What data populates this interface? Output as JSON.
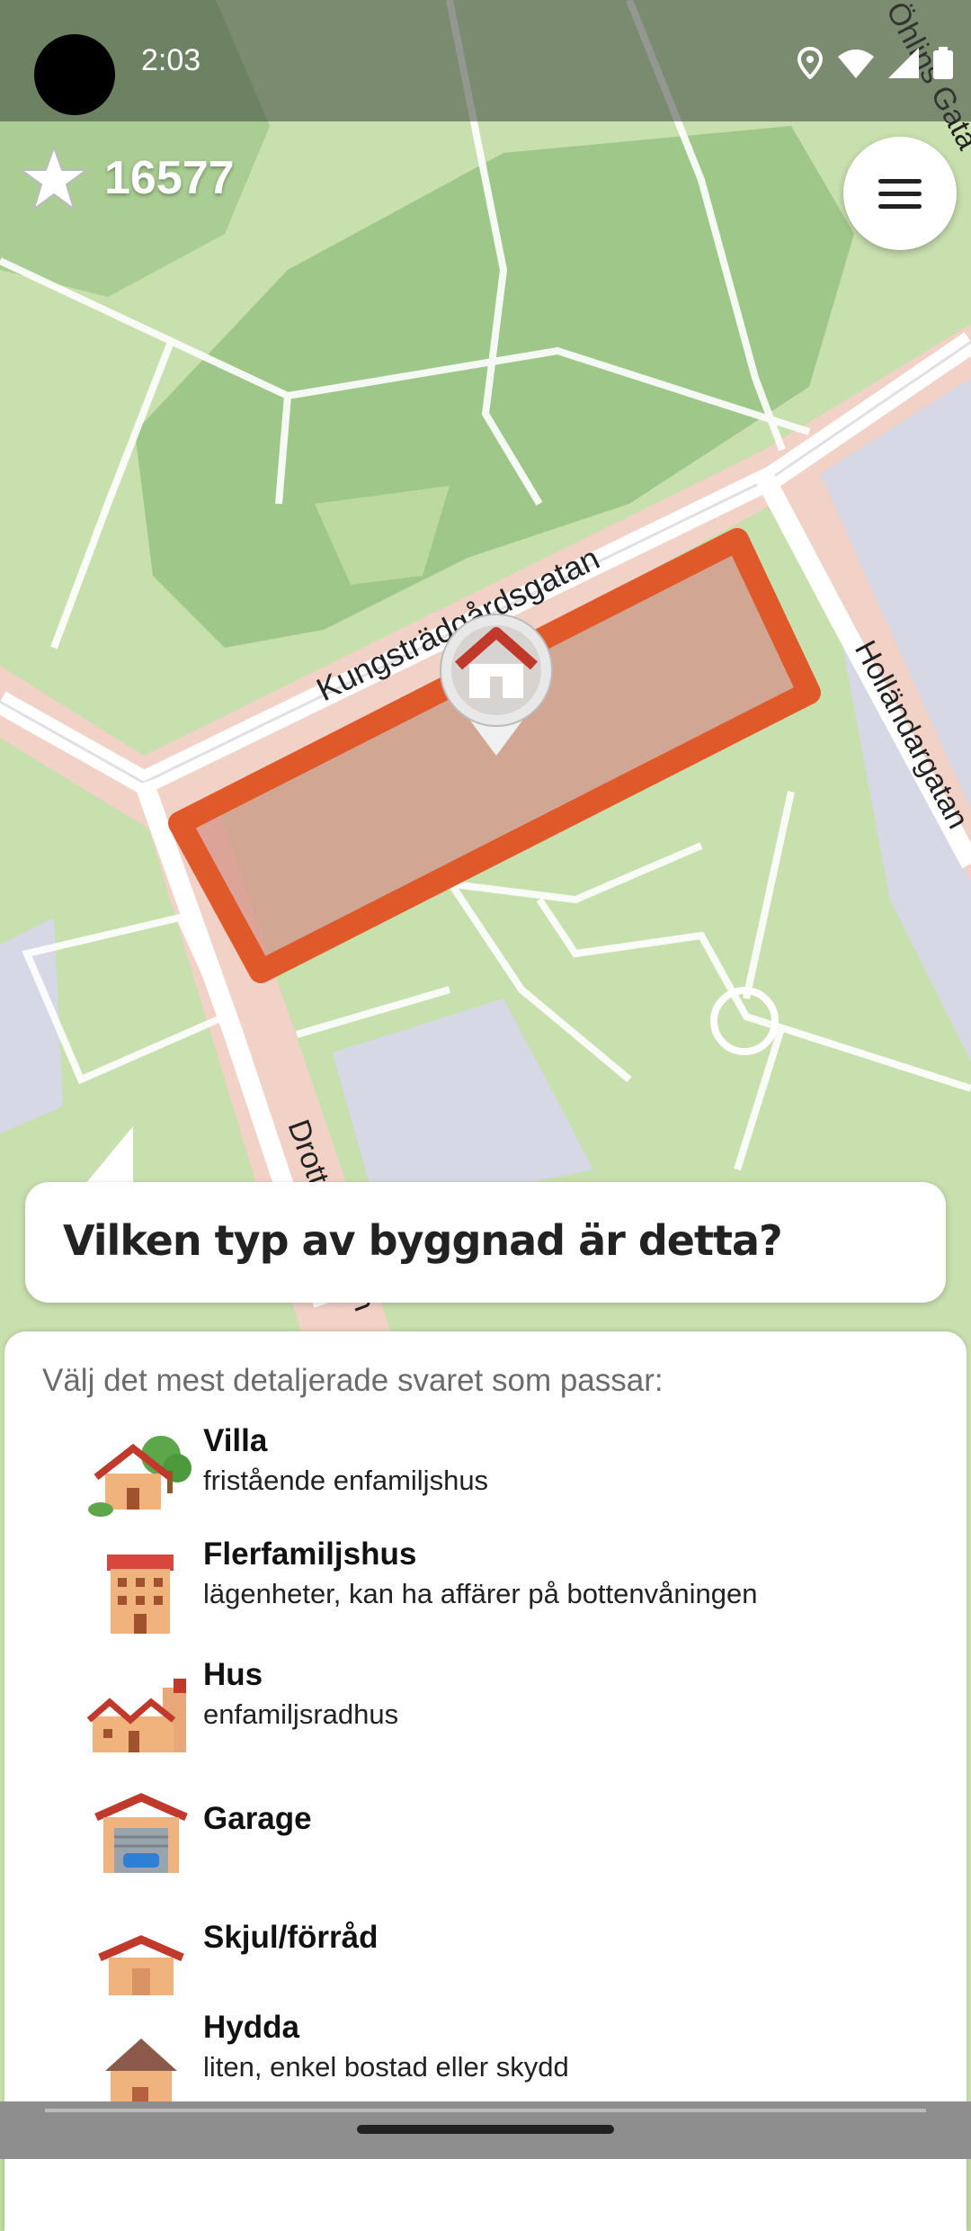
{
  "status_bar": {
    "time": "2:03"
  },
  "score": {
    "count": "16577"
  },
  "map": {
    "street_labels": [
      "Kungsträdgårdsgatan",
      "Holländargatan",
      "Drottninggatan",
      "Öhlins Gata"
    ]
  },
  "quest": {
    "question": "Vilken typ av byggnad är detta?",
    "hint": "Välj det mest detaljerade svaret som passar:",
    "options": [
      {
        "title": "Villa",
        "subtitle": "fristående enfamiljshus",
        "icon": "detached-house-icon"
      },
      {
        "title": "Flerfamiljshus",
        "subtitle": "lägenheter, kan ha affärer på bottenvåningen",
        "icon": "apartment-building-icon"
      },
      {
        "title": "Hus",
        "subtitle": "enfamiljsradhus",
        "icon": "terraced-house-icon"
      },
      {
        "title": "Garage",
        "subtitle": "",
        "icon": "garage-icon"
      },
      {
        "title": "Skjul/förråd",
        "subtitle": "",
        "icon": "shed-icon"
      },
      {
        "title": "Hydda",
        "subtitle": "liten, enkel bostad eller skydd",
        "icon": "hut-icon"
      }
    ]
  },
  "colors": {
    "highlight": "#e0592a",
    "park": "#bcd9a0",
    "road": "#f2d2c7"
  }
}
